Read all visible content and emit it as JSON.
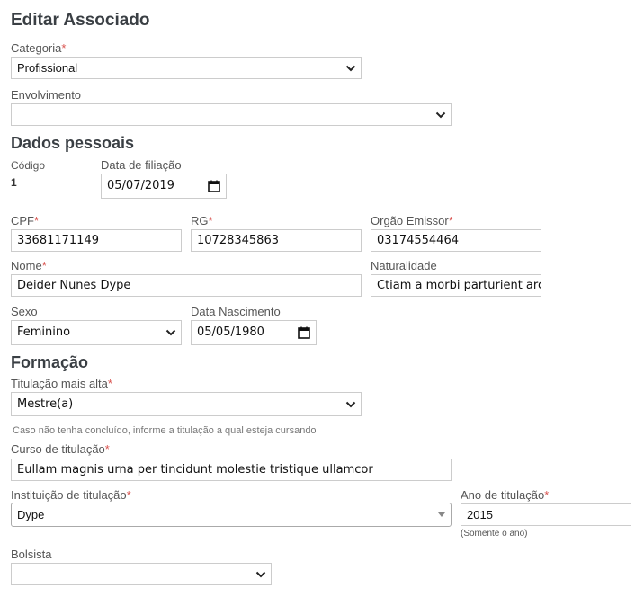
{
  "page_title": "Editar Associado",
  "categoria": {
    "label": "Categoria",
    "value": "Profissional"
  },
  "envolvimento": {
    "label": "Envolvimento",
    "value": ""
  },
  "dados_pessoais": {
    "title": "Dados pessoais",
    "codigo": {
      "label": "Código",
      "value": "1"
    },
    "data_filiacao": {
      "label": "Data de filiação",
      "value": "05/07/2019"
    },
    "cpf": {
      "label": "CPF",
      "value": "33681171149"
    },
    "rg": {
      "label": "RG",
      "value": "10728345863"
    },
    "orgao_emissor": {
      "label": "Orgão Emissor",
      "value": "03174554464"
    },
    "nome": {
      "label": "Nome",
      "value": "Deider Nunes Dype"
    },
    "naturalidade": {
      "label": "Naturalidade",
      "value": "Ctiam a morbi parturient arcu"
    },
    "sexo": {
      "label": "Sexo",
      "value": "Feminino"
    },
    "data_nascimento": {
      "label": "Data Nascimento",
      "value": "05/05/1980"
    }
  },
  "formacao": {
    "title": "Formação",
    "titulacao": {
      "label": "Titulação mais alta",
      "value": "Mestre(a)",
      "hint": "Caso não tenha concluído, informe a titulação a qual esteja cursando"
    },
    "curso": {
      "label": "Curso de titulação",
      "value": "Eullam magnis urna per tincidunt molestie tristique ullamcor"
    },
    "instituicao": {
      "label": "Instituição de titulação",
      "value": "Dype"
    },
    "ano": {
      "label": "Ano de titulação",
      "value": "2015",
      "hint": "(Somente o ano)"
    },
    "bolsista": {
      "label": "Bolsista",
      "value": ""
    }
  },
  "required_marker": "*",
  "colors": {
    "required": "#d9534f",
    "heading": "#3a3f44",
    "border": "#cccccc"
  },
  "icons": {
    "select": "chevron-down-icon",
    "date": "calendar-icon",
    "combo": "caret-down-icon"
  }
}
